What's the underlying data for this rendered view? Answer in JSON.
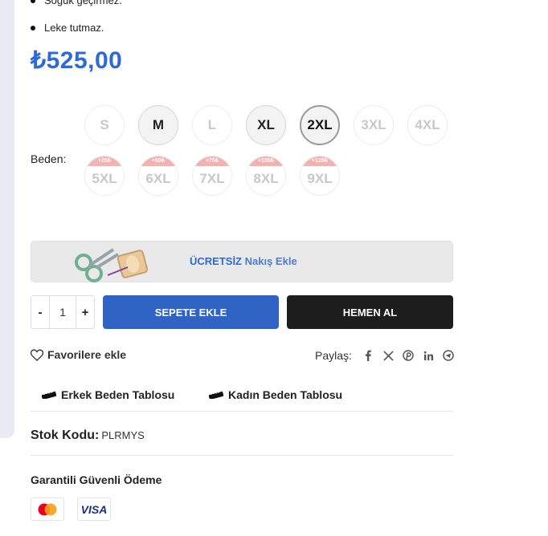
{
  "features": [
    "Soğuk geçirmez.",
    "Leke tutmaz."
  ],
  "price": "₺525,00",
  "size_label": "Beden",
  "sizes": [
    {
      "label": "S",
      "badge": ""
    },
    {
      "label": "M",
      "badge": ""
    },
    {
      "label": "L",
      "badge": ""
    },
    {
      "label": "XL",
      "badge": ""
    },
    {
      "label": "2XL",
      "badge": ""
    },
    {
      "label": "3XL",
      "badge": ""
    },
    {
      "label": "4XL",
      "badge": ""
    },
    {
      "label": "5XL",
      "badge": "+25₺"
    },
    {
      "label": "6XL",
      "badge": "+50₺"
    },
    {
      "label": "7XL",
      "badge": "+75₺"
    },
    {
      "label": "8XL",
      "badge": "+100₺"
    },
    {
      "label": "9XL",
      "badge": "+125₺"
    }
  ],
  "embroidery": {
    "bold": "ÜCRETSİZ",
    "rest": "Nakış Ekle"
  },
  "quantity": {
    "minus": "-",
    "value": "1",
    "plus": "+"
  },
  "add_to_cart": "SEPETE EKLE",
  "buy_now": "HEMEN AL",
  "favorites": "Favorilere ekle",
  "share_label": "Paylaş:",
  "share_icons": [
    "facebook-icon",
    "x-icon",
    "pinterest-icon",
    "linkedin-icon",
    "telegram-icon"
  ],
  "size_charts": {
    "male": "Erkek Beden Tablosu",
    "female": "Kadın Beden Tablosu"
  },
  "stock": {
    "label": "Stok Kodu:",
    "code": "PLRMYS"
  },
  "payment": {
    "title": "Garantili Güvenli Ödeme",
    "visa": "VISA"
  },
  "colors": {
    "accent": "#2f63c4",
    "price": "#2e6ad3",
    "buy": "#1d1d1d",
    "badge": "#f3b1b1"
  }
}
